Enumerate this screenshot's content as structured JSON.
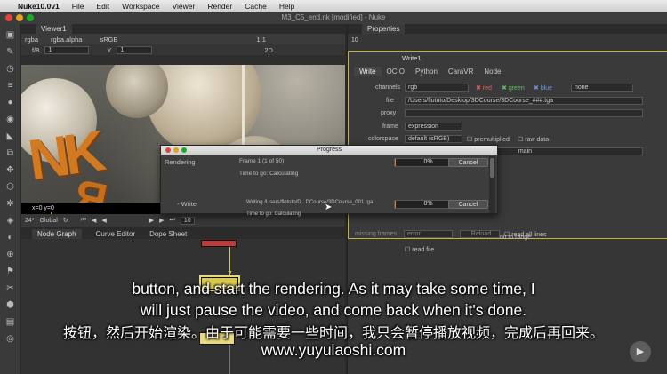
{
  "menubar": {
    "app": "Nuke10.0v1",
    "items": [
      "File",
      "Edit",
      "Workspace",
      "Viewer",
      "Render",
      "Cache",
      "Help"
    ]
  },
  "window_title": "M3_C5_end.nk [modified] - Nuke",
  "viewer": {
    "tab": "Viewer1",
    "channels": "rgba",
    "alpha": "rgba.alpha",
    "colorspace": "sRGB",
    "f_stop": "f/8",
    "frame_field": "1",
    "y_label": "Y",
    "y_field": "1",
    "zoom": "1:1",
    "mode": "2D",
    "coords": "x=0 y=0",
    "fps": "24*",
    "scope": "Global",
    "frame_input": "10",
    "ruler": [
      "1",
      "10",
      "20",
      "30",
      "40"
    ]
  },
  "nodegraph": {
    "tabs": [
      "Node Graph",
      "Curve Editor",
      "Dope Sheet"
    ]
  },
  "properties": {
    "tab": "Properties",
    "count": "10",
    "node_name": "Write1",
    "tabs": [
      "Write",
      "OCIO",
      "Python",
      "CaraVR",
      "Node"
    ],
    "channels_label": "channels",
    "channels_value": "rgb",
    "red": "red",
    "green": "green",
    "blue": "blue",
    "none": "none",
    "file_label": "file",
    "file_value": "/Users/flotuto/Desktop/3DCourse/3DCourse_###.tga",
    "proxy_label": "proxy",
    "frame_label": "frame",
    "frame_value": "expression",
    "colorspace_label": "colorspace",
    "colorspace_value": "default (sRGB)",
    "premultiplied": "premultiplied",
    "raw_data": "raw data",
    "views_label": "views",
    "views_value": "main",
    "range_text": "nit to range",
    "read_file": "read file",
    "missing_frames_label": "missing frames",
    "missing_value": "error",
    "reload": "Reload",
    "read_all_lines": "read all lines"
  },
  "progress_dialog": {
    "title": "Progress",
    "row1": {
      "label": "Rendering",
      "frame_text": "Frame 1 (1 of 50)",
      "time_text": "Time to go: Calculating",
      "percent": "0%",
      "cancel": "Cancel"
    },
    "row2": {
      "label": "- Write",
      "frame_text": "Writing /Users/flotuto/D...DCourse/3DCourse_001.tga",
      "time_text": "Time to go: Calculating",
      "percent": "0%",
      "cancel": "Cancel"
    },
    "progress_fraction": 0.0
  },
  "subtitles": {
    "line1": "button, and start the rendering. As it may take some time, I",
    "line2": "will just pause the video, and come back when it's done.",
    "line3": "按钮，然后开始渲染。由于可能需要一些时间，我只会暂停播放视频，完成后再回来。",
    "line4": "www.yuyulaoshi.com"
  },
  "colors": {
    "accent_orange": "#e08a1e",
    "node_yellow": "#d9c84a",
    "write_node": "#e8d97a",
    "panel": "#363636"
  }
}
